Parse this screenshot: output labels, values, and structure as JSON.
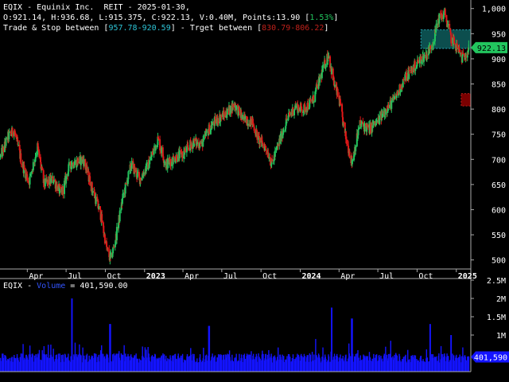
{
  "header": {
    "ticker": "EQIX",
    "sep": " - ",
    "company": "Equinix Inc.",
    "sector": "REIT",
    "date": "2025-01-30,",
    "ohlc_line": "O:921.14, H:936.68, L:915.375, C:922.13, V:0.40M, Points:13.90 [",
    "pct": "1.53%",
    "close_bracket": "]",
    "trade_stop_prefix": "Trade & Stop between [",
    "trade_stop_range": "957.78-920.59",
    "target_mid": "] - Trget between [",
    "target_range": "830.79-806.22",
    "target_suffix": "]"
  },
  "volume_header": {
    "ticker": "EQIX",
    "sep": " - ",
    "label": "Volume",
    "value_text": " = 401,590.00"
  },
  "price_tag": "922.13",
  "volume_tag": "401,590",
  "colors": {
    "background": "#000000",
    "up": "#22c55e",
    "down": "#e01818",
    "volume": "#1414ff",
    "trade_zone": "#0f5c5c",
    "target_zone": "#7a0000",
    "tag_bg": "#22c55e"
  },
  "chart_data": [
    {
      "type": "candlestick",
      "title": "EQIX - Equinix Inc. REIT",
      "y_ticks": [
        "1,000",
        "950",
        "900",
        "850",
        "800",
        "750",
        "700",
        "650",
        "600",
        "550",
        "500"
      ],
      "y_tick_values": [
        1000,
        950,
        900,
        850,
        800,
        750,
        700,
        650,
        600,
        550,
        500
      ],
      "ylim": [
        482,
        1017
      ],
      "x_ticks": [
        "Apr",
        "Jul",
        "Oct",
        "2023",
        "Apr",
        "Jul",
        "Oct",
        "2024",
        "Apr",
        "Jul",
        "Oct",
        "2025"
      ],
      "x_tick_bold": [
        false,
        false,
        false,
        true,
        false,
        false,
        false,
        true,
        false,
        false,
        false,
        true
      ],
      "x_tick_dates": [
        "2022-04-01",
        "2022-07-01",
        "2022-10-01",
        "2023-01-01",
        "2023-04-01",
        "2023-07-01",
        "2023-10-01",
        "2024-01-01",
        "2024-04-01",
        "2024-07-01",
        "2024-10-01",
        "2025-01-01"
      ],
      "xlim": [
        "2022-01-27",
        "2025-02-04"
      ],
      "grid": false,
      "close_path": [
        [
          "2022-01-28",
          705
        ],
        [
          "2022-02-15",
          745
        ],
        [
          "2022-03-01",
          758
        ],
        [
          "2022-03-20",
          690
        ],
        [
          "2022-04-05",
          655
        ],
        [
          "2022-04-25",
          725
        ],
        [
          "2022-05-10",
          650
        ],
        [
          "2022-06-01",
          660
        ],
        [
          "2022-06-20",
          630
        ],
        [
          "2022-07-10",
          690
        ],
        [
          "2022-08-10",
          700
        ],
        [
          "2022-09-01",
          640
        ],
        [
          "2022-09-20",
          590
        ],
        [
          "2022-10-05",
          520
        ],
        [
          "2022-10-13",
          500
        ],
        [
          "2022-10-25",
          540
        ],
        [
          "2022-11-10",
          620
        ],
        [
          "2022-12-01",
          690
        ],
        [
          "2022-12-20",
          660
        ],
        [
          "2023-01-10",
          690
        ],
        [
          "2023-02-01",
          740
        ],
        [
          "2023-02-20",
          690
        ],
        [
          "2023-03-15",
          705
        ],
        [
          "2023-04-01",
          710
        ],
        [
          "2023-04-25",
          735
        ],
        [
          "2023-05-15",
          730
        ],
        [
          "2023-06-01",
          760
        ],
        [
          "2023-06-20",
          780
        ],
        [
          "2023-07-10",
          790
        ],
        [
          "2023-07-31",
          810
        ],
        [
          "2023-08-20",
          780
        ],
        [
          "2023-09-10",
          775
        ],
        [
          "2023-09-25",
          740
        ],
        [
          "2023-10-15",
          720
        ],
        [
          "2023-10-26",
          690
        ],
        [
          "2023-11-15",
          740
        ],
        [
          "2023-12-01",
          780
        ],
        [
          "2023-12-20",
          805
        ],
        [
          "2024-01-10",
          800
        ],
        [
          "2024-02-01",
          820
        ],
        [
          "2024-02-20",
          870
        ],
        [
          "2024-03-07",
          910
        ],
        [
          "2024-03-20",
          850
        ],
        [
          "2024-04-01",
          820
        ],
        [
          "2024-04-15",
          750
        ],
        [
          "2024-05-01",
          695
        ],
        [
          "2024-05-20",
          770
        ],
        [
          "2024-06-10",
          760
        ],
        [
          "2024-07-01",
          775
        ],
        [
          "2024-07-20",
          800
        ],
        [
          "2024-08-10",
          820
        ],
        [
          "2024-09-01",
          860
        ],
        [
          "2024-09-20",
          880
        ],
        [
          "2024-10-10",
          900
        ],
        [
          "2024-10-25",
          910
        ],
        [
          "2024-11-10",
          940
        ],
        [
          "2024-11-20",
          980
        ],
        [
          "2024-12-05",
          990
        ],
        [
          "2024-12-20",
          940
        ],
        [
          "2025-01-05",
          920
        ],
        [
          "2025-01-15",
          900
        ],
        [
          "2025-01-30",
          922.13
        ]
      ],
      "trade_zone": [
        920.59,
        957.78
      ],
      "target_zone": [
        806.22,
        830.79
      ],
      "zone_dates": [
        "2024-10-10",
        "2025-01-30"
      ],
      "target_zone_dates": [
        "2025-01-05",
        "2025-02-04"
      ],
      "last_price": 922.13,
      "last_bar": {
        "date": "2025-01-30",
        "open": 921.14,
        "high": 936.68,
        "low": 915.375,
        "close": 922.13
      }
    },
    {
      "type": "bar",
      "title": "EQIX - Volume",
      "y_ticks": [
        "2.5M",
        "2M",
        "1.5M",
        "1M"
      ],
      "y_tick_values": [
        2500000,
        2000000,
        1500000,
        1000000
      ],
      "ylim": [
        0,
        2500000
      ],
      "spikes": [
        [
          "2022-07-15",
          2000000
        ],
        [
          "2022-10-12",
          1300000
        ],
        [
          "2023-06-01",
          1250000
        ],
        [
          "2024-03-15",
          1750000
        ],
        [
          "2024-05-01",
          1450000
        ],
        [
          "2024-11-01",
          1300000
        ],
        [
          "2024-12-20",
          1000000
        ]
      ],
      "last_value": 401590
    }
  ]
}
